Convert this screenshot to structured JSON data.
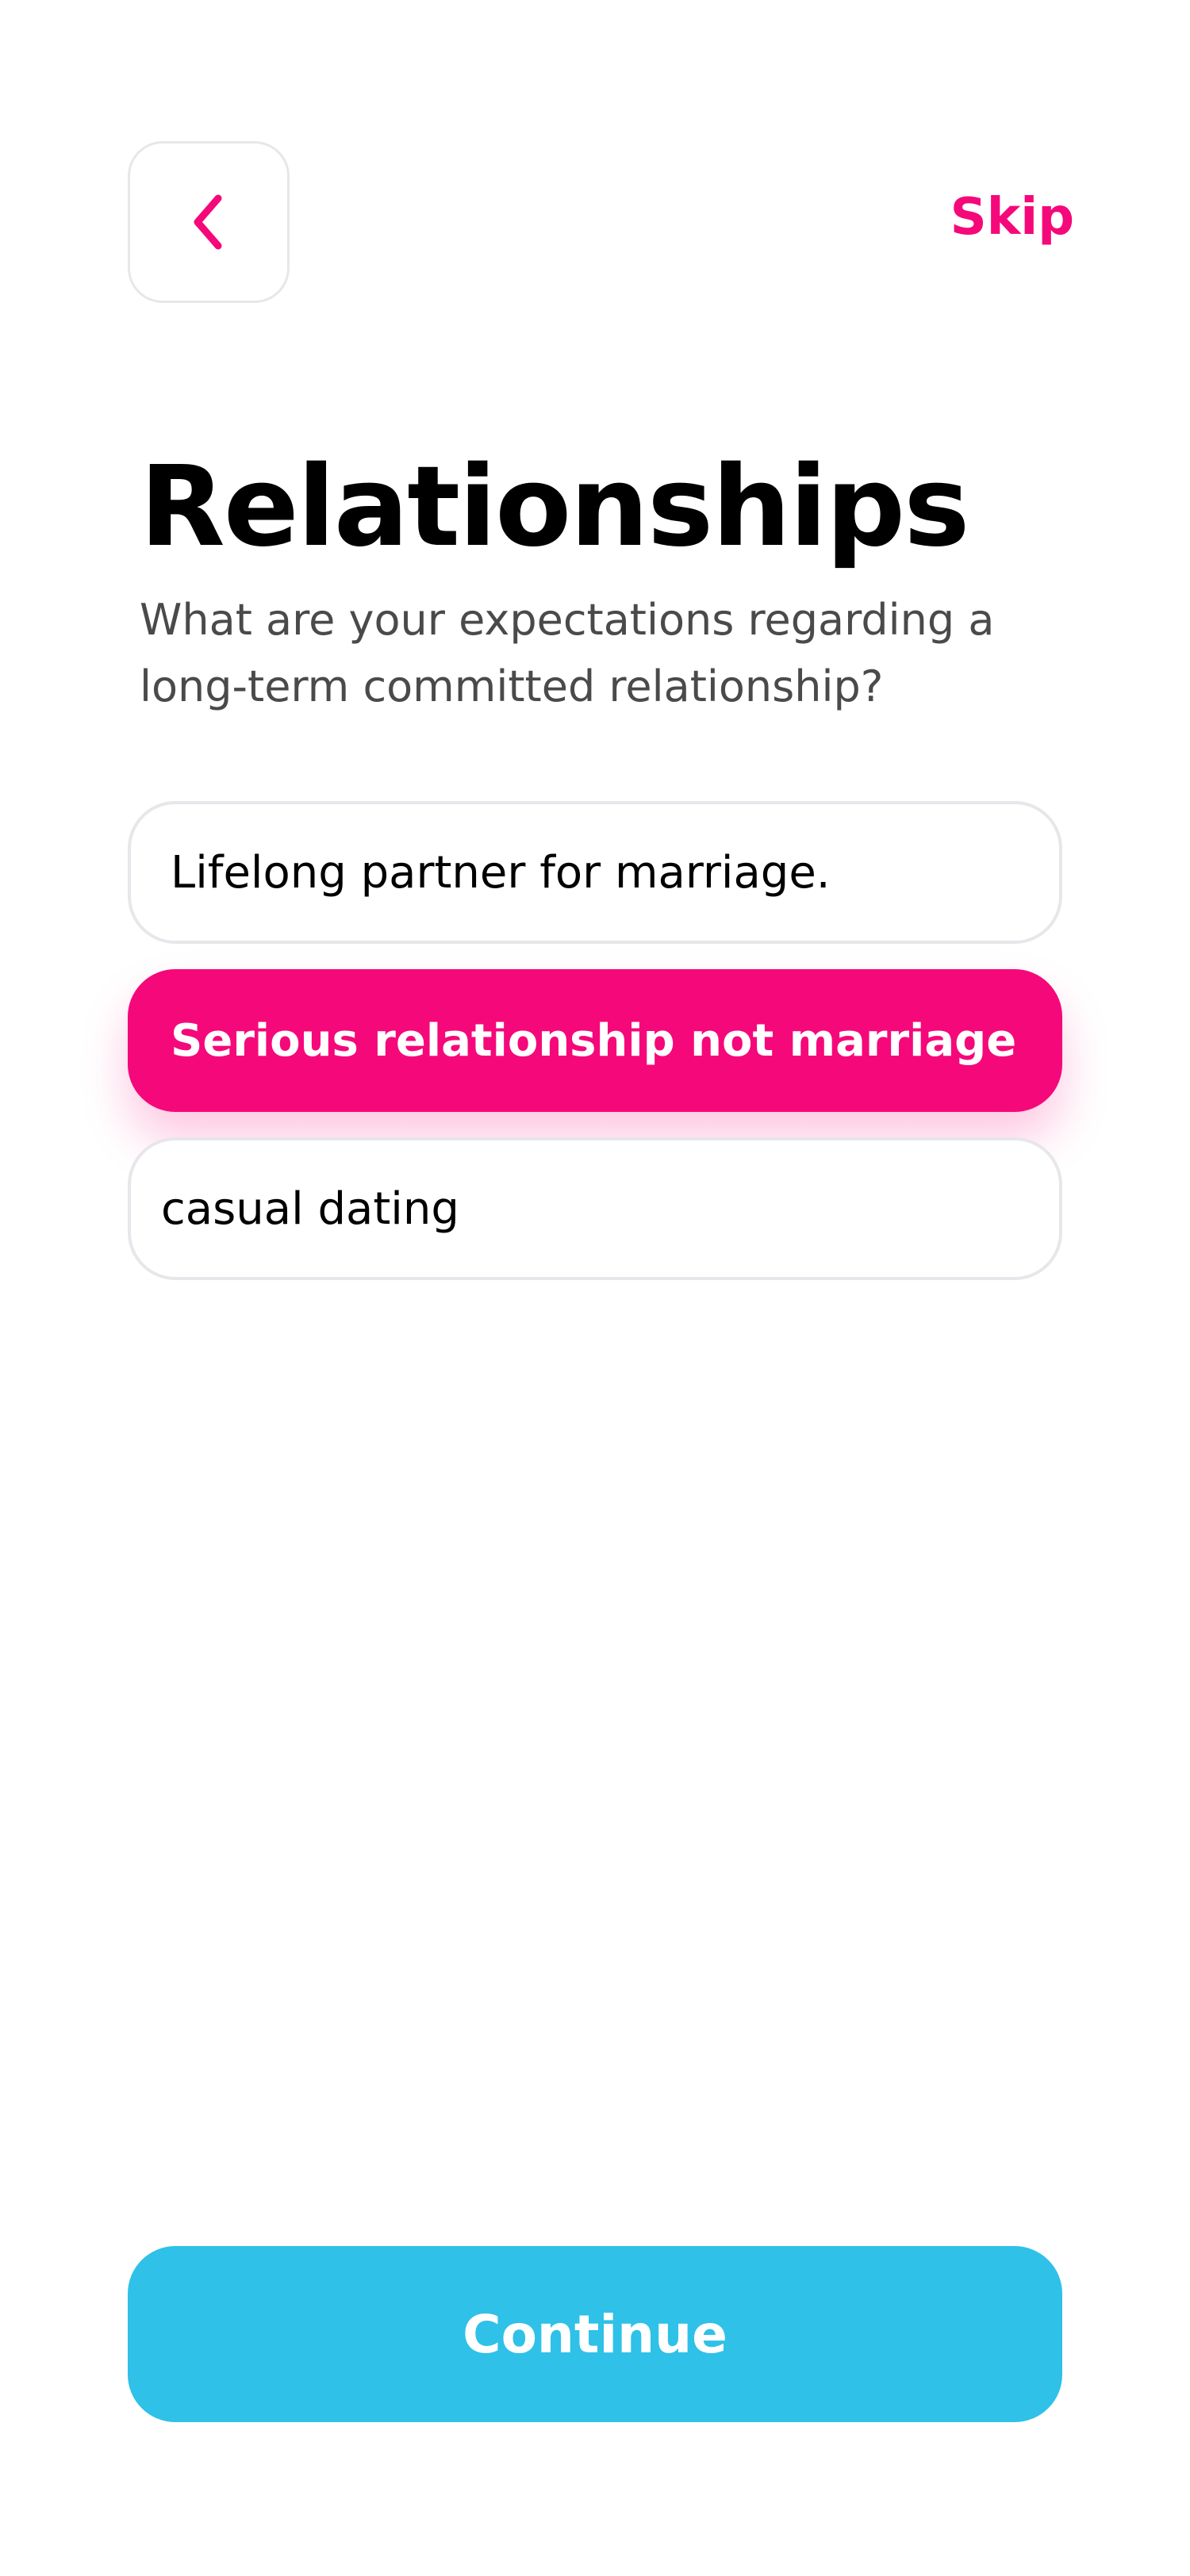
{
  "header": {
    "back_icon": "chevron-left-icon",
    "skip_label": "Skip"
  },
  "title": "Relationships",
  "subtitle": "What are your expectations regarding a long-term committed relationship?",
  "options": [
    {
      "label": "Lifelong partner for marriage.",
      "selected": false
    },
    {
      "label": "Serious relationship not marriage",
      "selected": true
    },
    {
      "label": "casual dating",
      "selected": false
    }
  ],
  "continue_label": "Continue",
  "colors": {
    "accent": "#f5087a",
    "button": "#2fc1e7",
    "border": "#e8e6ea",
    "subtitle_text": "#4a4a4a"
  }
}
